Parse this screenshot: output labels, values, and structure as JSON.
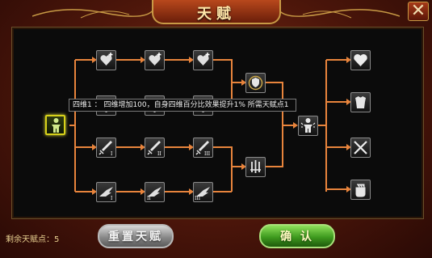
{
  "window": {
    "title": "天赋"
  },
  "tooltip": {
    "text": "四维1 ： 四维增加100，自身四维百分比效果提升1%  所需天赋点1"
  },
  "footer": {
    "points_label": "剩余天赋点：5"
  },
  "buttons": {
    "reset_label": "重置天赋",
    "confirm_label": "确 认"
  },
  "colors": {
    "line": "#e8843c",
    "selected_border": "#d8d21a",
    "frame": "#c89a45"
  },
  "tree": {
    "root": {
      "icon": "figure-icon",
      "selected": true
    },
    "row1": [
      "heart-plus-icon",
      "heart-plus-icon",
      "heart-plus-icon"
    ],
    "row2": [
      "shield-icon",
      "shield-icon",
      "shield-icon"
    ],
    "row3": [
      "sword-i-icon",
      "sword-ii-icon",
      "sword-iii-icon"
    ],
    "row4": [
      "wing-i-icon",
      "wing-ii-icon",
      "wing-iii-icon"
    ],
    "merge_top": "shield-gold-icon",
    "merge_bottom": "sword-triple-icon",
    "center": "figure-icon",
    "outputs": [
      "heart-icon",
      "armor-icon",
      "swords-cross-icon",
      "fist-icon"
    ]
  }
}
